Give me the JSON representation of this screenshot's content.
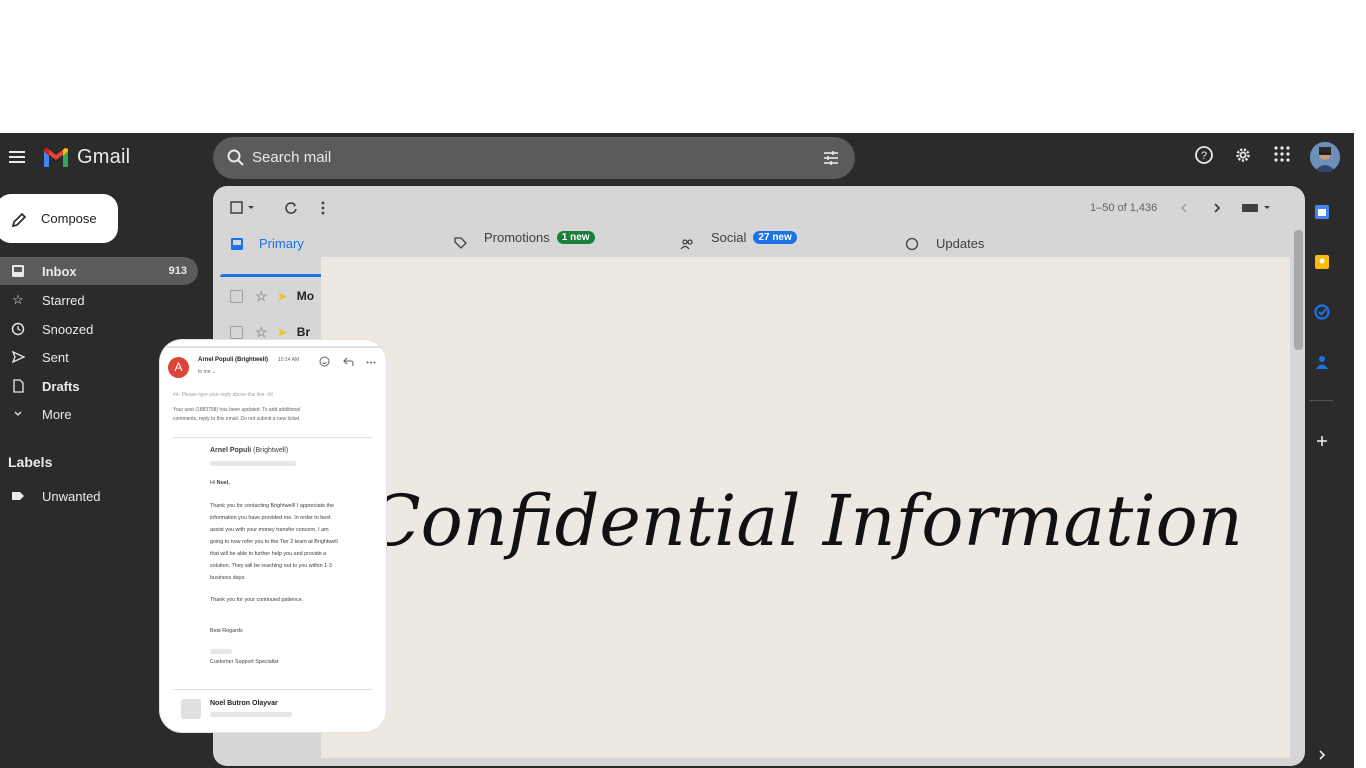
{
  "app": {
    "name": "Gmail"
  },
  "search": {
    "placeholder": "Search mail"
  },
  "sidebar": {
    "compose_label": "Compose",
    "items": [
      {
        "label": "Inbox",
        "count": "913",
        "icon": "inbox-icon"
      },
      {
        "label": "Starred",
        "icon": "star-icon"
      },
      {
        "label": "Snoozed",
        "icon": "clock-icon"
      },
      {
        "label": "Sent",
        "icon": "send-icon"
      },
      {
        "label": "Drafts",
        "icon": "draft-icon"
      },
      {
        "label": "More",
        "icon": "chevron-down-icon"
      }
    ],
    "labels_heading": "Labels",
    "labels": [
      {
        "label": "Unwanted",
        "icon": "label-icon"
      }
    ]
  },
  "toolbar": {
    "pagination": "1–50 of 1,436"
  },
  "tabs": [
    {
      "label": "Primary",
      "icon": "inbox-icon"
    },
    {
      "label": "Promotions",
      "badge": "1 new",
      "badge_color": "#188038",
      "icon": "tag-icon"
    },
    {
      "label": "Social",
      "badge": "27 new",
      "badge_color": "#1a73e8",
      "icon": "people-icon"
    },
    {
      "label": "Updates",
      "icon": "info-icon"
    }
  ],
  "rows": [
    {
      "sender": "Mo"
    },
    {
      "sender": "Br"
    }
  ],
  "overlay": {
    "text": "Confidential Information"
  },
  "email_card": {
    "avatar_letter": "A",
    "sender": "Arnel Populi (Brightwell)",
    "time": "10:14 AM",
    "to": "to me ⌄",
    "reply_line": "##- Please type your reply above this line -##",
    "notice_line1": "Your      uest (1883758) has been updated. To add additional",
    "notice_line2": "comments, reply to this email. Do not submit a new ticket.",
    "author_name": "Arnel Populi",
    "author_org": " (Brightwell)",
    "greeting_prefix": "Hi ",
    "greeting_name": "Noel,",
    "body": [
      "Thank you for contacting Brightwell! I appreciate the",
      "information you have provided me. In order to best",
      "assist you with your money transfer concern, I am",
      "going to now refer you to the Tier 2 team at Brightwell",
      "that will be able to further help you and provide a",
      "solution. They will be reaching out to you within 1-3",
      "business days."
    ],
    "patience": "Thank you for your continued patience.",
    "regards": "Best Regards",
    "role": "Customer Support Specialist",
    "next_sender": "Noel Butron Olayvar"
  },
  "colors": {
    "accent": "#1a73e8",
    "app_background": "#2b2b2b",
    "overlay_background": "#ede8e2"
  }
}
